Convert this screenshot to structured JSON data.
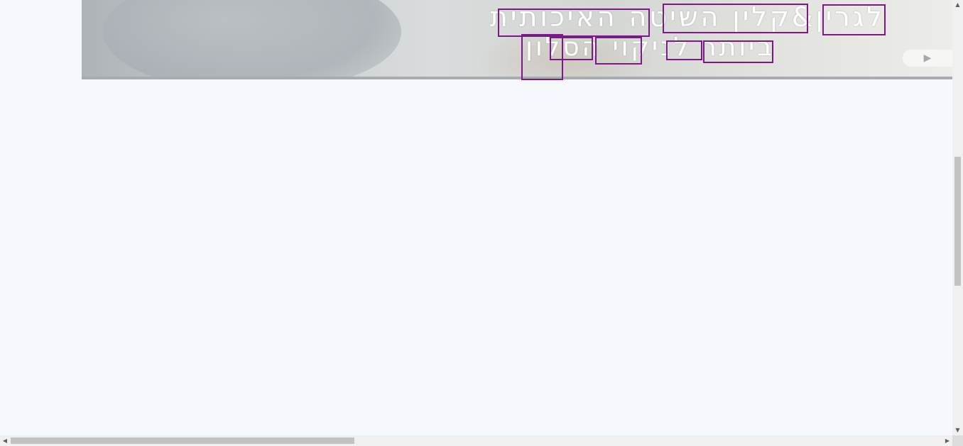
{
  "banner": {
    "line1": "לגרין&קלין השיטה האיכותית",
    "line2": "ביותר לניקוי הסלון",
    "play_icon": "▶"
  },
  "highlight_color": "#7a1a86",
  "scrollbars": {
    "up_icon": "▲",
    "down_icon": "▼",
    "left_icon": "◀",
    "right_icon": "▶"
  }
}
